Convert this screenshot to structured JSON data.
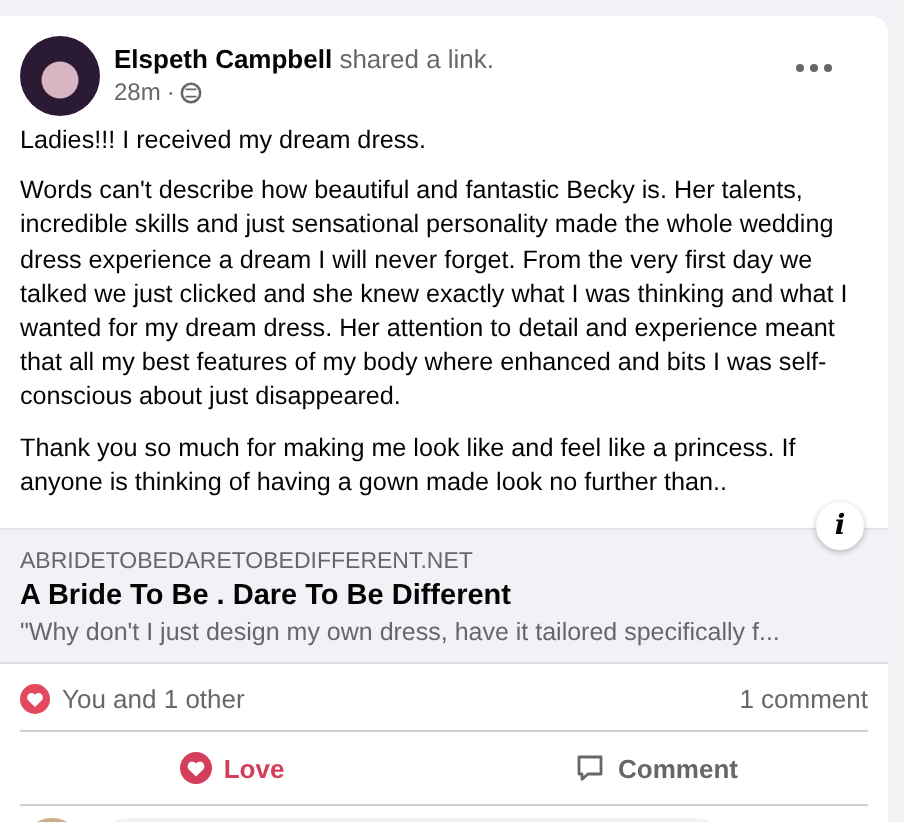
{
  "post": {
    "author": "Elspeth Campbell",
    "action": "shared a link.",
    "time": "28m",
    "separator": "·",
    "paragraphs": [
      "Ladies!!! I received my dream dress.",
      "Words can't describe how beautiful and fantastic Becky is. Her talents, incredible skills and just sensational personality made the whole wedding dress experience a dream I will never forget. From the very first day we talked we just clicked and she knew exactly what I was thinking and what I wanted for my dream dress. Her attention to detail and experience meant that all my best features of my body where enhanced and bits I was self-conscious about just disappeared.",
      "Thank you so much for making me look like and feel like a princess. If anyone is thinking of having a gown made look no further than.."
    ]
  },
  "info_button": "i",
  "link_preview": {
    "domain": "ABRIDETOBEDARETOBEDIFFERENT.NET",
    "title": "A Bride To Be . Dare To Be Different",
    "description": "\"Why don't I just design my own dress, have it tailored specifically f..."
  },
  "reactions": {
    "summary": "You and 1 other",
    "comments": "1 comment"
  },
  "actions": [
    {
      "kind": "love",
      "label": "Love",
      "selected": true
    },
    {
      "kind": "comment",
      "label": "Comment",
      "selected": false
    }
  ]
}
